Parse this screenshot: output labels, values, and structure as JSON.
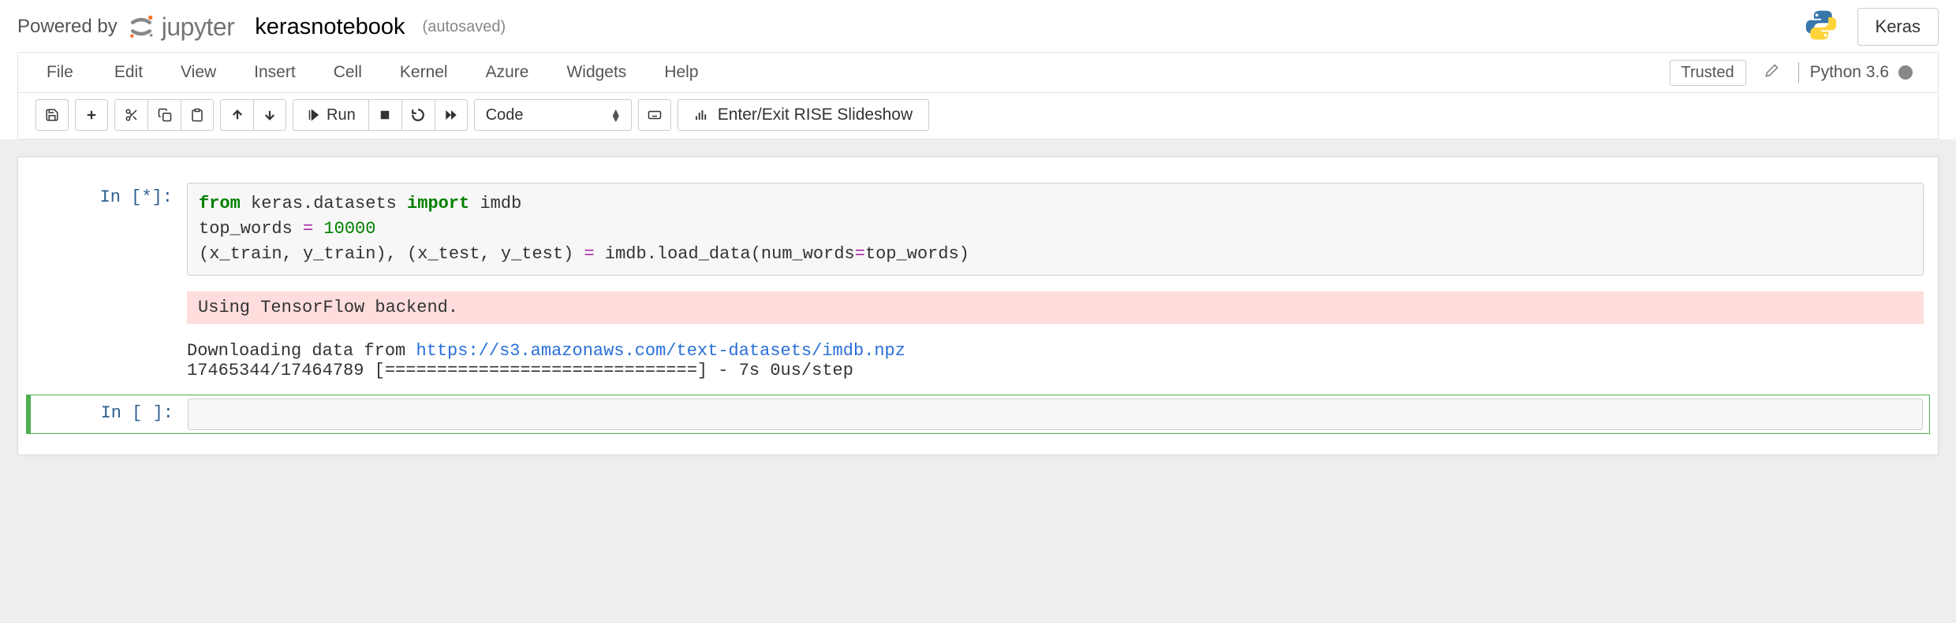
{
  "header": {
    "powered_by": "Powered by",
    "jupyter_name": "jupyter",
    "notebook_name": "kerasnotebook",
    "autosaved": "(autosaved)",
    "kernel_box": "Keras"
  },
  "menubar": {
    "items": [
      "File",
      "Edit",
      "View",
      "Insert",
      "Cell",
      "Kernel",
      "Azure",
      "Widgets",
      "Help"
    ],
    "trusted": "Trusted",
    "kernel_name": "Python 3.6"
  },
  "toolbar": {
    "run_label": "Run",
    "celltype": "Code",
    "rise_label": "Enter/Exit RISE Slideshow"
  },
  "cells": {
    "c1": {
      "prompt": "In [*]:",
      "code": {
        "l1a": "from",
        "l1b": " keras.datasets ",
        "l1c": "import",
        "l1d": " imdb",
        "l2a": "top_words ",
        "l2b": "=",
        "l2c": " 10000",
        "l3a": "(x_train, y_train), (x_test, y_test) ",
        "l3b": "=",
        "l3c": " imdb.load_data(num_words",
        "l3d": "=",
        "l3e": "top_words)"
      },
      "stderr": "Using TensorFlow backend.",
      "stdout_pre": "Downloading data from ",
      "stdout_url": "https://s3.amazonaws.com/text-datasets/imdb.npz",
      "stdout_line2": "17465344/17464789 [==============================] - 7s 0us/step"
    },
    "c2": {
      "prompt": "In [ ]:"
    }
  }
}
